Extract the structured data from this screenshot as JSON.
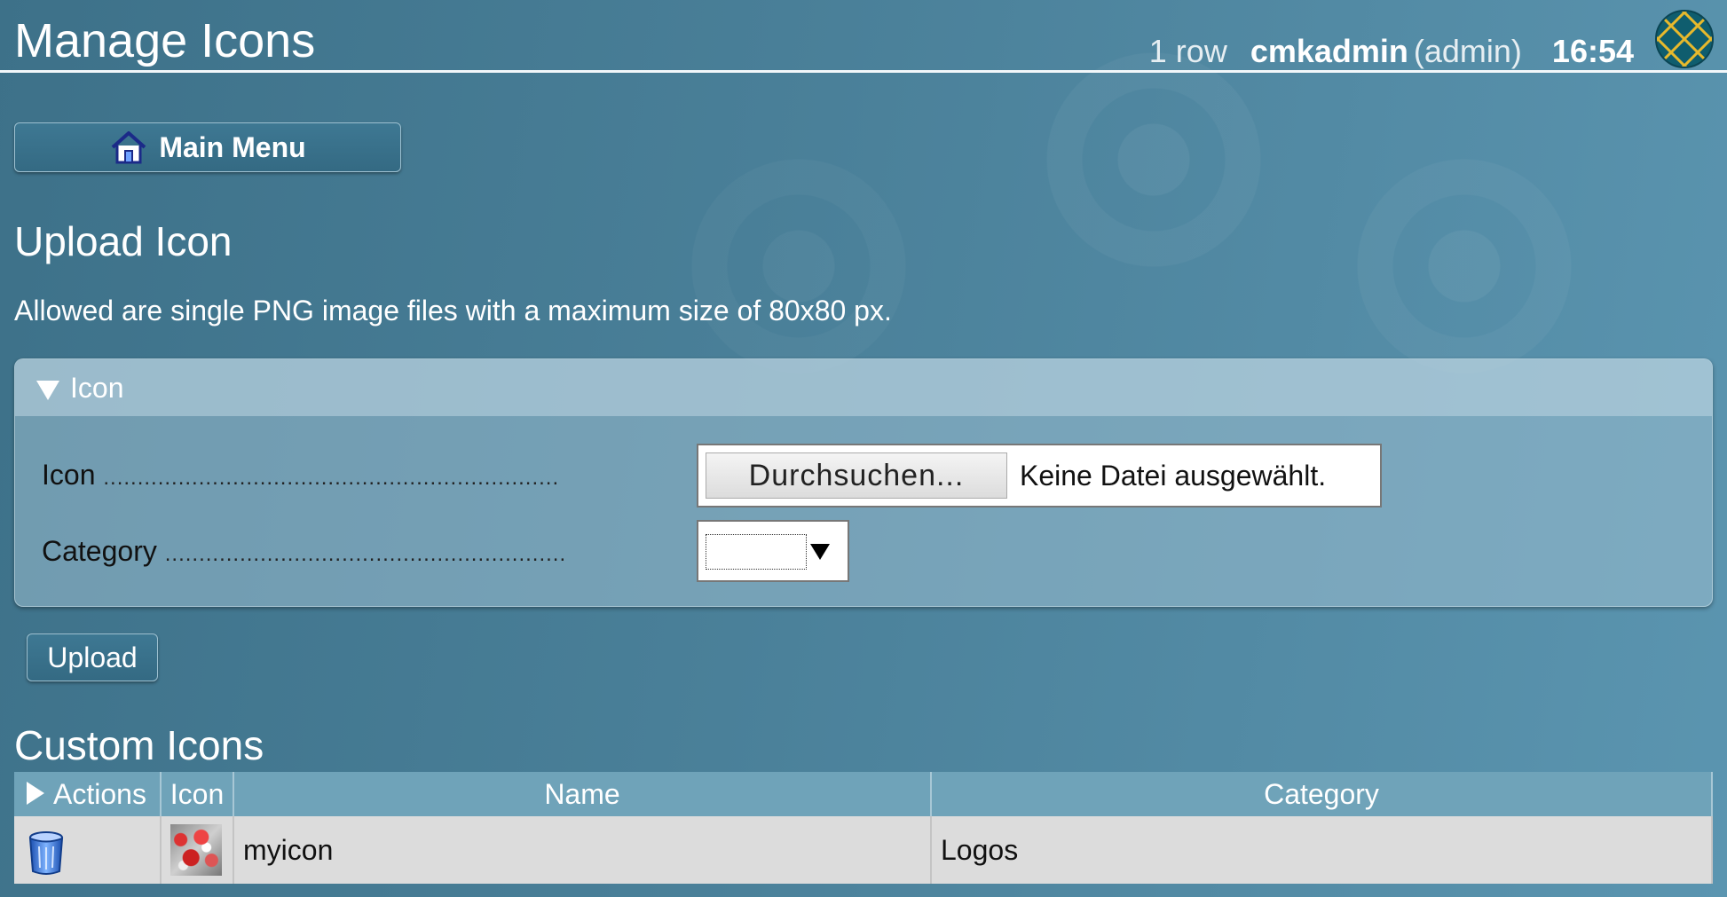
{
  "header": {
    "title": "Manage Icons",
    "row_count": "1 row",
    "username": "cmkadmin",
    "role": "(admin)",
    "clock": "16:54"
  },
  "nav": {
    "main_menu_label": "Main Menu"
  },
  "upload_section": {
    "title": "Upload Icon",
    "info": "Allowed are single PNG image files with a maximum size of 80x80 px.",
    "panel_title": "Icon",
    "icon_label": "Icon",
    "icon_dots": "...................................................................",
    "browse_label": "Durchsuchen...",
    "file_status": "Keine Datei ausgewählt.",
    "category_label": "Category",
    "category_dots": "...........................................................",
    "category_selected": "",
    "upload_label": "Upload"
  },
  "custom_icons": {
    "title": "Custom Icons",
    "columns": [
      "Actions",
      "Icon",
      "Name",
      "Category"
    ],
    "rows": [
      {
        "name": "myicon",
        "category": "Logos"
      }
    ]
  },
  "icons": {
    "logo": "globe-logo-icon",
    "home": "home-icon",
    "delete": "trash-icon"
  }
}
